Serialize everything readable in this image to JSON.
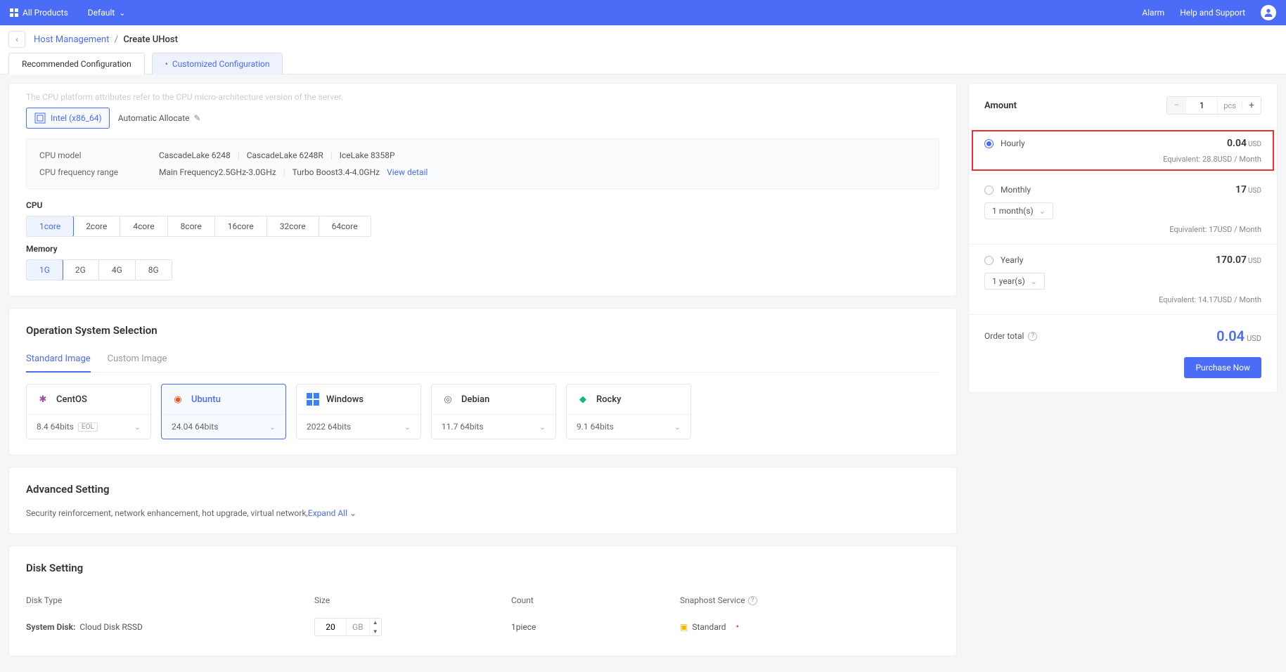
{
  "topbar": {
    "all_products": "All Products",
    "default": "Default",
    "alarm": "Alarm",
    "help": "Help and Support"
  },
  "breadcrumb": {
    "host_mgmt": "Host Management",
    "create": "Create UHost"
  },
  "tabs": {
    "recommended": "Recommended Configuration",
    "customized": "Customized Configuration"
  },
  "cpu_platform": {
    "truncated_hint": "The CPU platform attributes refer to the CPU micro-architecture version of the server.",
    "intel": "Intel (x86_64)",
    "auto": "Automatic Allocate",
    "model_label": "CPU model",
    "models": [
      "CascadeLake 6248",
      "CascadeLake 6248R",
      "IceLake 8358P"
    ],
    "freq_label": "CPU frequency range",
    "main_freq": "Main Frequency2.5GHz-3.0GHz",
    "turbo": "Turbo Boost3.4-4.0GHz",
    "view_detail": "View detail"
  },
  "cpu": {
    "label": "CPU",
    "options": [
      "1core",
      "2core",
      "4core",
      "8core",
      "16core",
      "32core",
      "64core"
    ]
  },
  "memory": {
    "label": "Memory",
    "options": [
      "1G",
      "2G",
      "4G",
      "8G"
    ]
  },
  "os": {
    "title": "Operation System Selection",
    "std_tab": "Standard Image",
    "custom_tab": "Custom Image",
    "items": [
      {
        "name": "CentOS",
        "ver": "8.4 64bits",
        "eol": "EOL"
      },
      {
        "name": "Ubuntu",
        "ver": "24.04 64bits"
      },
      {
        "name": "Windows",
        "ver": "2022 64bits"
      },
      {
        "name": "Debian",
        "ver": "11.7 64bits"
      },
      {
        "name": "Rocky",
        "ver": "9.1 64bits"
      }
    ]
  },
  "adv": {
    "title": "Advanced Setting",
    "desc": "Security reinforcement, network enhancement, hot upgrade, virtual network,",
    "expand": "Expand All"
  },
  "disk": {
    "title": "Disk Setting",
    "cols": {
      "type": "Disk Type",
      "size": "Size",
      "count": "Count",
      "snap": "Snaphost Service"
    },
    "row": {
      "label": "System Disk:",
      "val": "Cloud Disk RSSD",
      "size": "20",
      "unit": "GB",
      "count": "1piece",
      "snap": "Standard"
    }
  },
  "aside": {
    "amount_label": "Amount",
    "amount_val": "1",
    "amount_unit": "pcs",
    "hourly": {
      "name": "Hourly",
      "price": "0.04",
      "cur": "USD",
      "eq": "Equivalent: 28.8USD / Month"
    },
    "monthly": {
      "name": "Monthly",
      "price": "17",
      "cur": "USD",
      "sel": "1 month(s)",
      "eq": "Equivalent: 17USD / Month"
    },
    "yearly": {
      "name": "Yearly",
      "price": "170.07",
      "cur": "USD",
      "sel": "1 year(s)",
      "eq": "Equivalent: 14.17USD / Month"
    },
    "order_label": "Order total",
    "order_val": "0.04",
    "order_cur": "USD",
    "purchase": "Purchase Now"
  }
}
